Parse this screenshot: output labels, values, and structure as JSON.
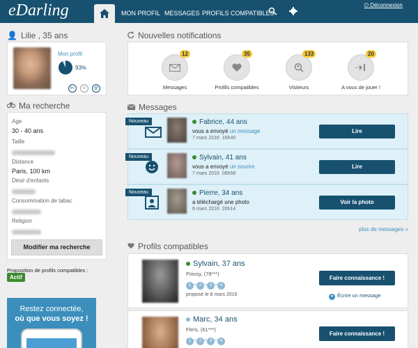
{
  "header": {
    "logo": "eDarling",
    "nav": [
      "MON PROFIL",
      "MESSAGES",
      "PROFILS COMPATIBLES"
    ],
    "logout": "Déconnexion"
  },
  "user": {
    "name_age": "Lilie , 35 ans",
    "profile_label": "Mon profil",
    "profile_percent": "93%",
    "profile_fraction": 0.93
  },
  "search": {
    "title": "Ma recherche",
    "fields": [
      {
        "label": "Age",
        "value": "30 - 40 ans",
        "blurred": false
      },
      {
        "label": "Taille",
        "value": "",
        "blurred": true
      },
      {
        "label": "Distance",
        "value": "Paris, 100 km",
        "blurred": false
      },
      {
        "label": "Désir d'enfants",
        "value": "",
        "blurred": true
      },
      {
        "label": "Consommation de tabac",
        "value": "",
        "blurred": true
      },
      {
        "label": "Religion",
        "value": "",
        "blurred": true
      }
    ],
    "button": "Modifier ma recherche"
  },
  "proposition": {
    "label": "Proposition de profils compatibles :",
    "status": "Actif"
  },
  "promo": {
    "line1": "Restez connectée,",
    "line2": "où que vous soyez !"
  },
  "notifications": {
    "title": "Nouvelles notifications",
    "items": [
      {
        "label": "Messages",
        "count": "12",
        "icon": "envelope-icon"
      },
      {
        "label": "Profils compatibles",
        "count": "35",
        "icon": "heart-icon"
      },
      {
        "label": "Visiteurs",
        "count": "133",
        "icon": "visitor-icon"
      },
      {
        "label": "A vous de jouer !",
        "count": "20",
        "icon": "play-turn-icon"
      }
    ]
  },
  "messages": {
    "title": "Messages",
    "items": [
      {
        "badge": "Nouveau",
        "name": "Fabrice, 44 ans",
        "text_prefix": "vous a envoyé ",
        "text_link": "un message",
        "date": "7 mars 2016",
        "time": "16h40",
        "button": "Lire",
        "icon": "envelope-icon"
      },
      {
        "badge": "Nouveau",
        "name": "Sylvain, 41 ans",
        "text_prefix": "vous a envoyé ",
        "text_link": "un sourire",
        "date": "7 mars 2016",
        "time": "06h58",
        "button": "Lire",
        "icon": "smile-icon"
      },
      {
        "badge": "Nouveau",
        "name": "Pierre, 34 ans",
        "text_prefix": "a téléchargé une photo",
        "text_link": "",
        "date": "6 mars 2016",
        "time": "20h14",
        "button": "Voir la photo",
        "icon": "photo-icon"
      }
    ],
    "more": "plus de messages »"
  },
  "profiles": {
    "title": "Profils compatibles",
    "items": [
      {
        "name": "Sylvain, 37 ans",
        "location": "Poissy, (78***)",
        "steps": [
          "1",
          "2",
          "3",
          "4"
        ],
        "proposed": "proposé le 8 mars 2016",
        "button": "Faire connaissance !",
        "write": "Écrire un message",
        "status_color": "#3b8b2e"
      },
      {
        "name": "Marc, 34 ans",
        "location": "Flers, (61***)",
        "steps": [
          "1",
          "2",
          "3",
          "4"
        ],
        "proposed": "",
        "button": "Faire connaissance !",
        "write": "",
        "status_color": "#8fb9d5"
      }
    ]
  },
  "colors": {
    "header": "#17516f",
    "accent": "#3c8fbd",
    "online": "#3b8b2e",
    "badge": "#f3c83a",
    "message_bg": "#def0f8"
  }
}
